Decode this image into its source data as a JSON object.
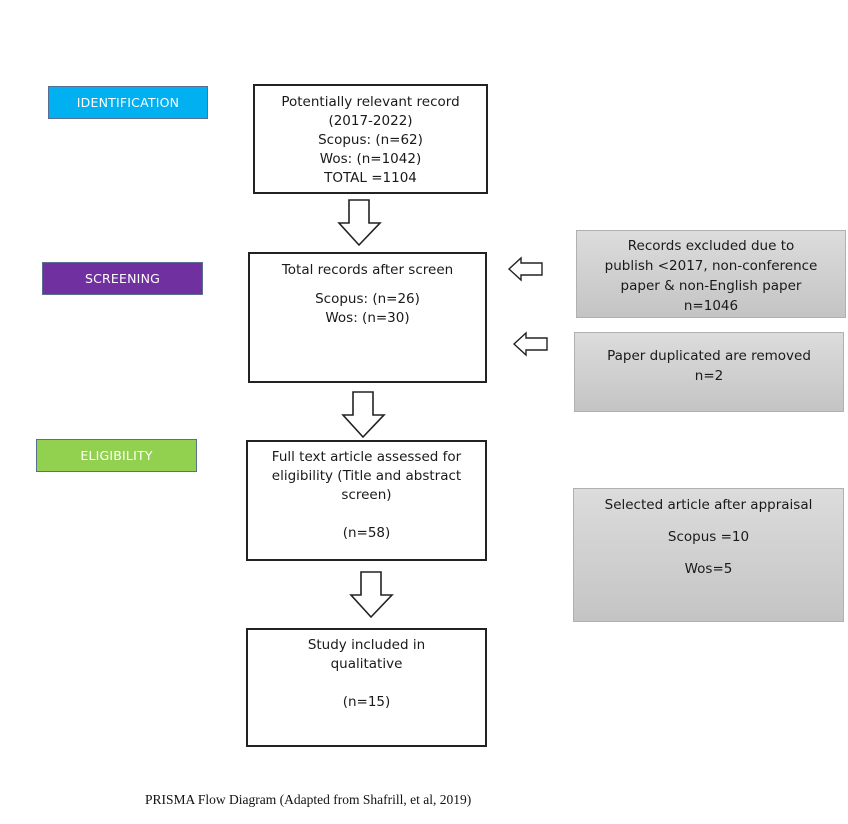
{
  "stages": {
    "identification": {
      "label": "IDENTIFICATION",
      "color": "#00b0f0"
    },
    "screening": {
      "label": "SCREENING",
      "color": "#7030a0"
    },
    "eligibility": {
      "label": "ELIGIBILITY",
      "color": "#92d050"
    }
  },
  "boxes": {
    "identification": {
      "lines": [
        "Potentially relevant record",
        "(2017-2022)",
        "Scopus: (n=62)",
        "Wos: (n=1042)",
        "TOTAL =1104"
      ]
    },
    "screening": {
      "title": "Total records after screen",
      "lines": [
        "Scopus: (n=26)",
        "Wos: (n=30)"
      ]
    },
    "eligibility": {
      "lines": [
        "Full text article assessed for",
        "eligibility (Title and abstract",
        "screen)"
      ],
      "count": "(n=58)"
    },
    "included": {
      "lines": [
        "Study included in",
        "qualitative"
      ],
      "count": "(n=15)"
    }
  },
  "side_boxes": {
    "excluded": {
      "lines": [
        "Records excluded due to",
        "publish <2017, non-conference",
        "paper & non-English paper",
        "n=1046"
      ]
    },
    "duplicates": {
      "lines": [
        "Paper duplicated are removed",
        "n=2"
      ]
    },
    "selected": {
      "title": "Selected article after appraisal",
      "scopus": "Scopus =10",
      "wos": "Wos=5"
    }
  },
  "caption": "PRISMA Flow Diagram (Adapted from Shafrill, et al, 2019)"
}
